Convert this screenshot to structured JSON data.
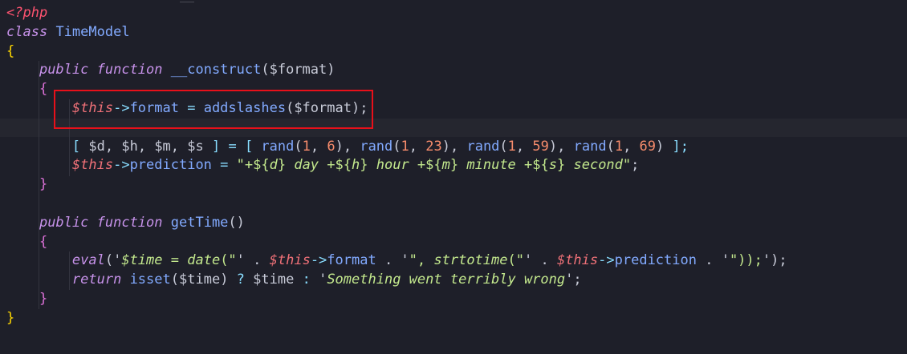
{
  "code": {
    "lines": [
      [
        {
          "t": "<?php",
          "c": "tag"
        }
      ],
      [
        {
          "t": "class",
          "c": "kw"
        },
        {
          "t": " ",
          "c": "plain"
        },
        {
          "t": "TimeModel",
          "c": "fn"
        }
      ],
      [
        {
          "t": "{",
          "c": "brace"
        }
      ],
      [
        {
          "t": "    ",
          "c": "plain"
        },
        {
          "t": "public",
          "c": "kw"
        },
        {
          "t": " ",
          "c": "plain"
        },
        {
          "t": "function",
          "c": "kw"
        },
        {
          "t": " ",
          "c": "plain"
        },
        {
          "t": "__construct",
          "c": "fn"
        },
        {
          "t": "(",
          "c": "plain"
        },
        {
          "t": "$format",
          "c": "plain"
        },
        {
          "t": ")",
          "c": "plain"
        }
      ],
      [
        {
          "t": "    ",
          "c": "plain"
        },
        {
          "t": "{",
          "c": "brace2"
        }
      ],
      [
        {
          "t": "        ",
          "c": "plain"
        },
        {
          "t": "$this",
          "c": "this"
        },
        {
          "t": "->",
          "c": "op"
        },
        {
          "t": "format",
          "c": "fn"
        },
        {
          "t": " = ",
          "c": "op"
        },
        {
          "t": "addslashes",
          "c": "fn"
        },
        {
          "t": "(",
          "c": "plain"
        },
        {
          "t": "$format",
          "c": "plain"
        },
        {
          "t": ");",
          "c": "plain"
        }
      ],
      [],
      [
        {
          "t": "        ",
          "c": "plain"
        },
        {
          "t": "[ ",
          "c": "op"
        },
        {
          "t": "$d",
          "c": "plain"
        },
        {
          "t": ", ",
          "c": "plain"
        },
        {
          "t": "$h",
          "c": "plain"
        },
        {
          "t": ", ",
          "c": "plain"
        },
        {
          "t": "$m",
          "c": "plain"
        },
        {
          "t": ", ",
          "c": "plain"
        },
        {
          "t": "$s",
          "c": "plain"
        },
        {
          "t": " ] = [ ",
          "c": "op"
        },
        {
          "t": "rand",
          "c": "fn"
        },
        {
          "t": "(",
          "c": "plain"
        },
        {
          "t": "1",
          "c": "num"
        },
        {
          "t": ", ",
          "c": "plain"
        },
        {
          "t": "6",
          "c": "num"
        },
        {
          "t": "), ",
          "c": "plain"
        },
        {
          "t": "rand",
          "c": "fn"
        },
        {
          "t": "(",
          "c": "plain"
        },
        {
          "t": "1",
          "c": "num"
        },
        {
          "t": ", ",
          "c": "plain"
        },
        {
          "t": "23",
          "c": "num"
        },
        {
          "t": "), ",
          "c": "plain"
        },
        {
          "t": "rand",
          "c": "fn"
        },
        {
          "t": "(",
          "c": "plain"
        },
        {
          "t": "1",
          "c": "num"
        },
        {
          "t": ", ",
          "c": "plain"
        },
        {
          "t": "59",
          "c": "num"
        },
        {
          "t": "), ",
          "c": "plain"
        },
        {
          "t": "rand",
          "c": "fn"
        },
        {
          "t": "(",
          "c": "plain"
        },
        {
          "t": "1",
          "c": "num"
        },
        {
          "t": ", ",
          "c": "plain"
        },
        {
          "t": "69",
          "c": "num"
        },
        {
          "t": ")",
          "c": "plain"
        },
        {
          "t": " ];",
          "c": "op"
        }
      ],
      [
        {
          "t": "        ",
          "c": "plain"
        },
        {
          "t": "$this",
          "c": "this"
        },
        {
          "t": "->",
          "c": "op"
        },
        {
          "t": "prediction",
          "c": "fn"
        },
        {
          "t": " = ",
          "c": "op"
        },
        {
          "t": "\"+${",
          "c": "str"
        },
        {
          "t": "d",
          "c": "stri"
        },
        {
          "t": "} ",
          "c": "str"
        },
        {
          "t": "day",
          "c": "stri"
        },
        {
          "t": " +${",
          "c": "str"
        },
        {
          "t": "h",
          "c": "stri"
        },
        {
          "t": "} ",
          "c": "str"
        },
        {
          "t": "hour",
          "c": "stri"
        },
        {
          "t": " +${",
          "c": "str"
        },
        {
          "t": "m",
          "c": "stri"
        },
        {
          "t": "} ",
          "c": "str"
        },
        {
          "t": "minute",
          "c": "stri"
        },
        {
          "t": " +${",
          "c": "str"
        },
        {
          "t": "s",
          "c": "stri"
        },
        {
          "t": "} ",
          "c": "str"
        },
        {
          "t": "second",
          "c": "stri"
        },
        {
          "t": "\"",
          "c": "str"
        },
        {
          "t": ";",
          "c": "plain"
        }
      ],
      [
        {
          "t": "    ",
          "c": "plain"
        },
        {
          "t": "}",
          "c": "brace2"
        }
      ],
      [],
      [
        {
          "t": "    ",
          "c": "plain"
        },
        {
          "t": "public",
          "c": "kw"
        },
        {
          "t": " ",
          "c": "plain"
        },
        {
          "t": "function",
          "c": "kw"
        },
        {
          "t": " ",
          "c": "plain"
        },
        {
          "t": "getTime",
          "c": "fn"
        },
        {
          "t": "()",
          "c": "plain"
        }
      ],
      [
        {
          "t": "    ",
          "c": "plain"
        },
        {
          "t": "{",
          "c": "brace2"
        }
      ],
      [
        {
          "t": "        ",
          "c": "plain"
        },
        {
          "t": "eval",
          "c": "kw"
        },
        {
          "t": "('",
          "c": "plain"
        },
        {
          "t": "$time",
          "c": "stri"
        },
        {
          "t": " = ",
          "c": "str"
        },
        {
          "t": "date",
          "c": "stri"
        },
        {
          "t": "(\"",
          "c": "str"
        },
        {
          "t": "' . ",
          "c": "plain"
        },
        {
          "t": "$this",
          "c": "this"
        },
        {
          "t": "->",
          "c": "op"
        },
        {
          "t": "format",
          "c": "fn"
        },
        {
          "t": " . '",
          "c": "plain"
        },
        {
          "t": "\", ",
          "c": "str"
        },
        {
          "t": "strtotime",
          "c": "stri"
        },
        {
          "t": "(\"",
          "c": "str"
        },
        {
          "t": "' . ",
          "c": "plain"
        },
        {
          "t": "$this",
          "c": "this"
        },
        {
          "t": "->",
          "c": "op"
        },
        {
          "t": "prediction",
          "c": "fn"
        },
        {
          "t": " . '",
          "c": "plain"
        },
        {
          "t": "\"));",
          "c": "str"
        },
        {
          "t": "');",
          "c": "plain"
        }
      ],
      [
        {
          "t": "        ",
          "c": "plain"
        },
        {
          "t": "return",
          "c": "kw"
        },
        {
          "t": " ",
          "c": "plain"
        },
        {
          "t": "isset",
          "c": "fn"
        },
        {
          "t": "(",
          "c": "plain"
        },
        {
          "t": "$time",
          "c": "plain"
        },
        {
          "t": ") ",
          "c": "plain"
        },
        {
          "t": "?",
          "c": "op"
        },
        {
          "t": " $time ",
          "c": "plain"
        },
        {
          "t": ":",
          "c": "op"
        },
        {
          "t": " '",
          "c": "plain"
        },
        {
          "t": "Something went terribly wrong",
          "c": "stri"
        },
        {
          "t": "';",
          "c": "plain"
        }
      ],
      [
        {
          "t": "    ",
          "c": "plain"
        },
        {
          "t": "}",
          "c": "brace2"
        }
      ],
      [
        {
          "t": "}",
          "c": "brace"
        }
      ]
    ],
    "highlighted_line": 6,
    "annotation": "red-box-around-line-6"
  },
  "colors": {
    "background": "#1e1f29",
    "annotation_box": "#e8101a"
  }
}
